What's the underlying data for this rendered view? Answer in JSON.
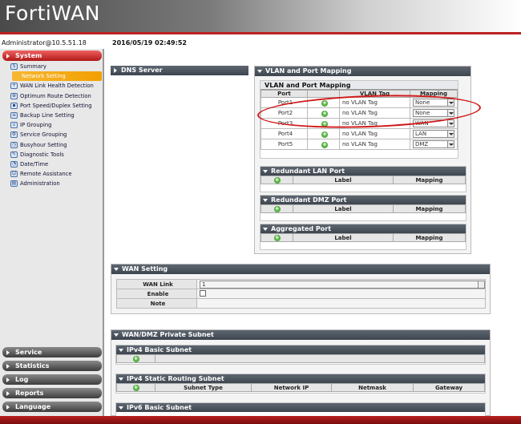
{
  "app": {
    "title": "FortiWAN"
  },
  "header": {
    "user": "Administrator@10.5.51.18",
    "datetime": "2016/05/19 02:49:52"
  },
  "sidebar": {
    "section": "System",
    "items": [
      {
        "label": "Summary",
        "icon": "summary-icon"
      },
      {
        "label": "Network Setting",
        "icon": "network-icon",
        "active": true
      },
      {
        "label": "WAN Link Health Detection",
        "icon": "health-icon"
      },
      {
        "label": "Optimum Route Detection",
        "icon": "route-icon"
      },
      {
        "label": "Port Speed/Duplex Setting",
        "icon": "port-icon"
      },
      {
        "label": "Backup Line Setting",
        "icon": "backup-icon"
      },
      {
        "label": "IP Grouping",
        "icon": "ip-group-icon"
      },
      {
        "label": "Service Grouping",
        "icon": "service-group-icon"
      },
      {
        "label": "Busyhour Setting",
        "icon": "clock-icon"
      },
      {
        "label": "Diagnostic Tools",
        "icon": "tools-icon"
      },
      {
        "label": "Date/Time",
        "icon": "calendar-icon"
      },
      {
        "label": "Remote Assistance",
        "icon": "remote-icon"
      },
      {
        "label": "Administration",
        "icon": "admin-icon"
      }
    ],
    "bottom": [
      "Service",
      "Statistics",
      "Log",
      "Reports",
      "Language"
    ]
  },
  "dns": {
    "title": "DNS Server"
  },
  "vlan": {
    "title": "VLAN and Port Mapping",
    "inner_title": "VLAN and Port Mapping",
    "columns": [
      "Port",
      "VLAN Tag",
      "Mapping"
    ],
    "rows": [
      {
        "port": "Port1",
        "tag": "no VLAN Tag",
        "mapping": "None"
      },
      {
        "port": "Port2",
        "tag": "no VLAN Tag",
        "mapping": "None"
      },
      {
        "port": "Port3",
        "tag": "no VLAN Tag",
        "mapping": "WAN"
      },
      {
        "port": "Port4",
        "tag": "no VLAN Tag",
        "mapping": "LAN"
      },
      {
        "port": "Port5",
        "tag": "no VLAN Tag",
        "mapping": "DMZ"
      }
    ],
    "redundant_lan": {
      "title": "Redundant LAN Port",
      "columns": [
        "Label",
        "Mapping"
      ]
    },
    "redundant_dmz": {
      "title": "Redundant DMZ Port",
      "columns": [
        "Label",
        "Mapping"
      ]
    },
    "aggregated": {
      "title": "Aggregated Port",
      "columns": [
        "Label",
        "Mapping"
      ]
    }
  },
  "wan": {
    "title": "WAN Setting",
    "link_label": "WAN Link",
    "link_value": "1",
    "enable_label": "Enable",
    "note_label": "Note"
  },
  "subnet": {
    "title": "WAN/DMZ Private Subnet",
    "ipv4_basic": "IPv4 Basic Subnet",
    "ipv4_static": "IPv4 Static Routing Subnet",
    "static_columns": [
      "Subnet Type",
      "Network IP",
      "Netmask",
      "Gateway"
    ],
    "ipv6_basic": "IPv6 Basic Subnet"
  },
  "colors": {
    "brand_red": "#b01818",
    "highlight_oval": "#d01818",
    "active_item": "#f2a000"
  }
}
